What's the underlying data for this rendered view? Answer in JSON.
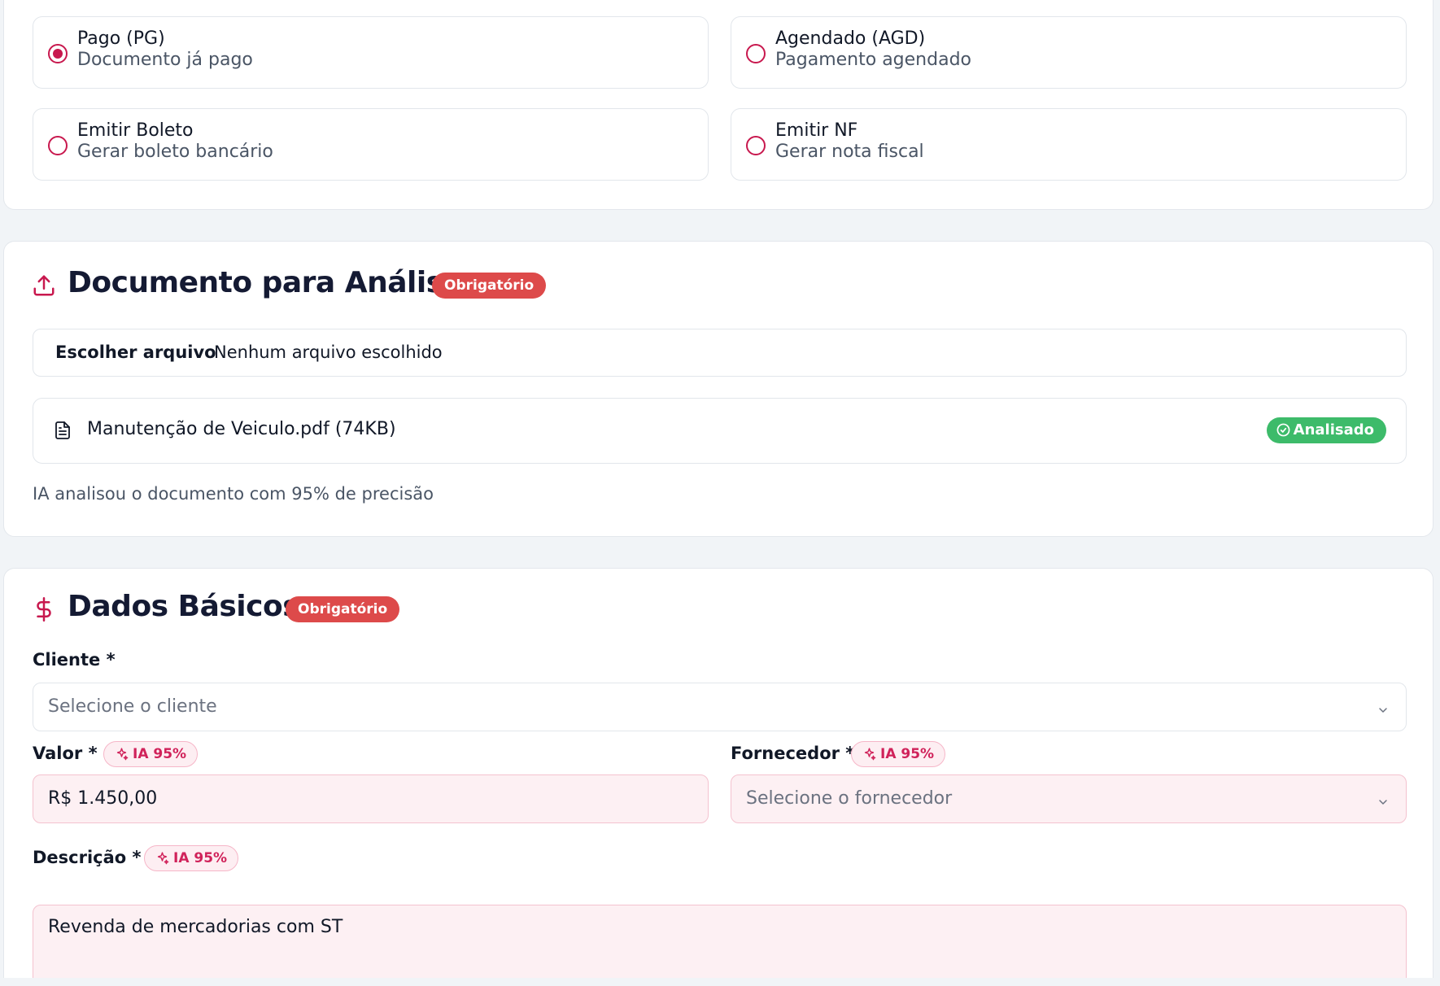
{
  "status_options": [
    {
      "title": "Pago (PG)",
      "subtitle": "Documento já pago",
      "checked": true
    },
    {
      "title": "Agendado (AGD)",
      "subtitle": "Pagamento agendado",
      "checked": false
    },
    {
      "title": "Emitir Boleto",
      "subtitle": "Gerar boleto bancário",
      "checked": false
    },
    {
      "title": "Emitir NF",
      "subtitle": "Gerar nota fiscal",
      "checked": false
    }
  ],
  "document_section": {
    "icon": "upload-icon",
    "title": "Documento para Análise",
    "badge": "Obrigatório",
    "file_button": "Escolher arquivo",
    "file_status": "Nenhum arquivo escolhido",
    "file": {
      "icon": "file-text-icon",
      "name": "Manutenção de Veiculo.pdf (74KB)",
      "status": "Analisado"
    },
    "ai_note": "IA analisou o documento com 95% de precisão"
  },
  "basic_section": {
    "icon": "dollar-icon",
    "title": "Dados Básicos",
    "badge": "Obrigatório",
    "client": {
      "label": "Cliente *",
      "placeholder": "Selecione o cliente"
    },
    "value": {
      "label": "Valor *",
      "ai_badge": "IA 95%",
      "value": "R$ 1.450,00"
    },
    "supplier": {
      "label": "Fornecedor *",
      "ai_badge": "IA 95%",
      "placeholder": "Selecione o fornecedor"
    },
    "description": {
      "label": "Descrição *",
      "ai_badge": "IA 95%",
      "value": "Revenda de mercadorias com ST"
    }
  },
  "colors": {
    "accent": "#c8184e",
    "required_badge": "#dd4a4a",
    "success": "#3dbb6a",
    "ai_field_bg": "#fdf0f3",
    "page_bg": "#f1f4f7"
  }
}
